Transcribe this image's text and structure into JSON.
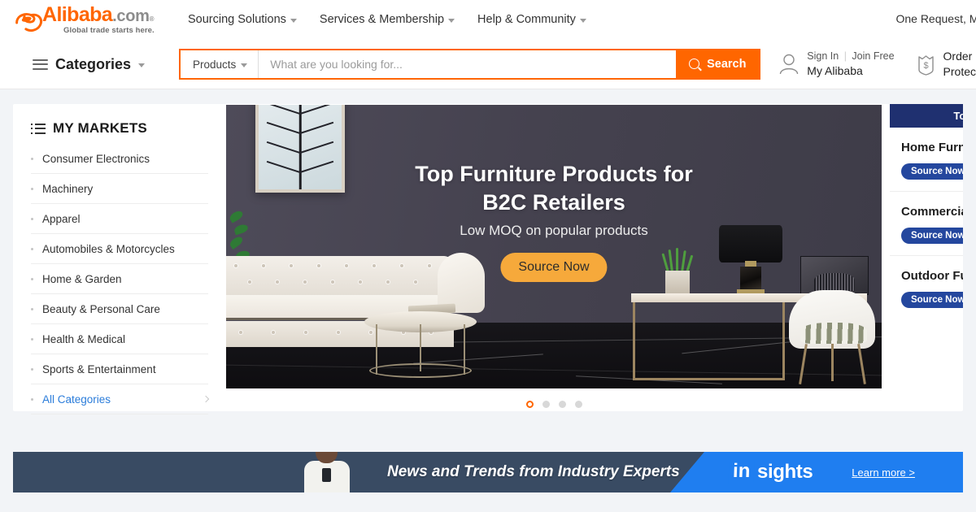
{
  "header": {
    "logo": {
      "brand": "Alibaba",
      "domain": ".com",
      "registered": "®",
      "tagline": "Global trade starts here."
    },
    "nav": [
      {
        "label": "Sourcing Solutions"
      },
      {
        "label": "Services & Membership"
      },
      {
        "label": "Help & Community"
      }
    ],
    "promo": "One Request, Multiple",
    "categories_label": "Categories",
    "search": {
      "category": "Products",
      "placeholder": "What are you looking for...",
      "value": "",
      "button": "Search"
    },
    "account": {
      "sign_in": "Sign In",
      "separator": "|",
      "join_free": "Join Free",
      "my_alibaba": "My Alibaba"
    },
    "order": {
      "line1": "Order",
      "line2": "Protec"
    }
  },
  "sidebar": {
    "title": "MY MARKETS",
    "items": [
      {
        "label": "Consumer Electronics",
        "active": false
      },
      {
        "label": "Machinery",
        "active": false
      },
      {
        "label": "Apparel",
        "active": false
      },
      {
        "label": "Automobiles & Motorcycles",
        "active": false
      },
      {
        "label": "Home & Garden",
        "active": false
      },
      {
        "label": "Beauty & Personal Care",
        "active": false
      },
      {
        "label": "Health & Medical",
        "active": false
      },
      {
        "label": "Sports & Entertainment",
        "active": false
      },
      {
        "label": "All Categories",
        "active": true
      }
    ]
  },
  "hero": {
    "title_line1": "Top Furniture Products for",
    "title_line2": "B2C Retailers",
    "subtitle": "Low MOQ on popular products",
    "cta": "Source Now",
    "slides": 4,
    "active_slide": 1
  },
  "rail": {
    "header": "Top Furnit",
    "cards": [
      {
        "title": "Home Furni",
        "button": "Source Now"
      },
      {
        "title": "Commercial",
        "button": "Source Now"
      },
      {
        "title": "Outdoor Fur",
        "button": "Source Now"
      }
    ]
  },
  "insights": {
    "headline": "News and Trends from Industry Experts",
    "logo_in": "in",
    "logo_sights": "sights",
    "learn_more": "Learn more >"
  },
  "colors": {
    "brand_orange": "#ff6600",
    "cta_amber": "#f6a93b",
    "rail_navy": "#1f3070",
    "rail_button_blue": "#24479e",
    "insights_dark": "#394b63",
    "insights_blue": "#1f7ef0",
    "link_blue": "#2a7cda"
  }
}
